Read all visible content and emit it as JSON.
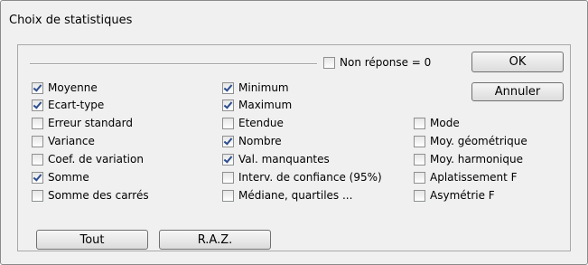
{
  "dialog": {
    "title": "Choix de statistiques",
    "non_reponse": {
      "label": "Non réponse = 0",
      "checked": false
    },
    "buttons": {
      "ok": "OK",
      "annuler": "Annuler",
      "tout": "Tout",
      "raz": "R.A.Z."
    },
    "col1": [
      {
        "label": "Moyenne",
        "checked": true
      },
      {
        "label": "Ecart-type",
        "checked": true
      },
      {
        "label": "Erreur standard",
        "checked": false
      },
      {
        "label": "Variance",
        "checked": false
      },
      {
        "label": "Coef. de variation",
        "checked": false
      },
      {
        "label": "Somme",
        "checked": true
      },
      {
        "label": "Somme des carrés",
        "checked": false
      }
    ],
    "col2": [
      {
        "label": "Minimum",
        "checked": true
      },
      {
        "label": "Maximum",
        "checked": true
      },
      {
        "label": "Etendue",
        "checked": false
      },
      {
        "label": "Nombre",
        "checked": true
      },
      {
        "label": "Val. manquantes",
        "checked": true
      },
      {
        "label": "Interv. de confiance (95%)",
        "checked": false
      },
      {
        "label": "Médiane, quartiles ...",
        "checked": false
      }
    ],
    "col3": [
      {
        "label": "Mode",
        "checked": false
      },
      {
        "label": "Moy. géométrique",
        "checked": false
      },
      {
        "label": "Moy. harmonique",
        "checked": false
      },
      {
        "label": "Aplatissement F",
        "checked": false
      },
      {
        "label": "Asymétrie F",
        "checked": false
      }
    ]
  }
}
